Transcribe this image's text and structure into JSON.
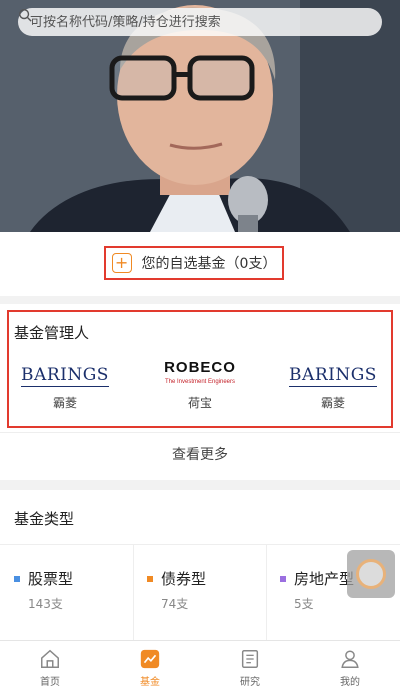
{
  "search": {
    "placeholder": "可按名称代码/策略/持仓进行搜索"
  },
  "watchlist": {
    "label": "您的自选基金（0支）"
  },
  "managers": {
    "title": "基金管理人",
    "items": [
      {
        "logo_text": "BARINGS",
        "name": "霸菱"
      },
      {
        "logo_text": "ROBECO",
        "logo_sub": "The Investment Engineers",
        "name": "荷宝"
      },
      {
        "logo_text": "BARINGS",
        "name": "霸菱"
      }
    ],
    "more_label": "查看更多"
  },
  "fund_types": {
    "title": "基金类型",
    "items": [
      {
        "label": "股票型",
        "count": "143支",
        "color": "#4a90e2"
      },
      {
        "label": "债券型",
        "count": "74支",
        "color": "#f08a24"
      },
      {
        "label": "房地产型",
        "count": "5支",
        "color": "#9b6fe0"
      }
    ]
  },
  "tabbar": {
    "items": [
      {
        "label": "首页",
        "icon": "home-icon"
      },
      {
        "label": "基金",
        "icon": "fund-chart-icon",
        "active": true
      },
      {
        "label": "研究",
        "icon": "research-doc-icon"
      },
      {
        "label": "我的",
        "icon": "user-icon"
      }
    ]
  },
  "colors": {
    "accent": "#f08a24",
    "highlight_border": "#e23a2e"
  }
}
